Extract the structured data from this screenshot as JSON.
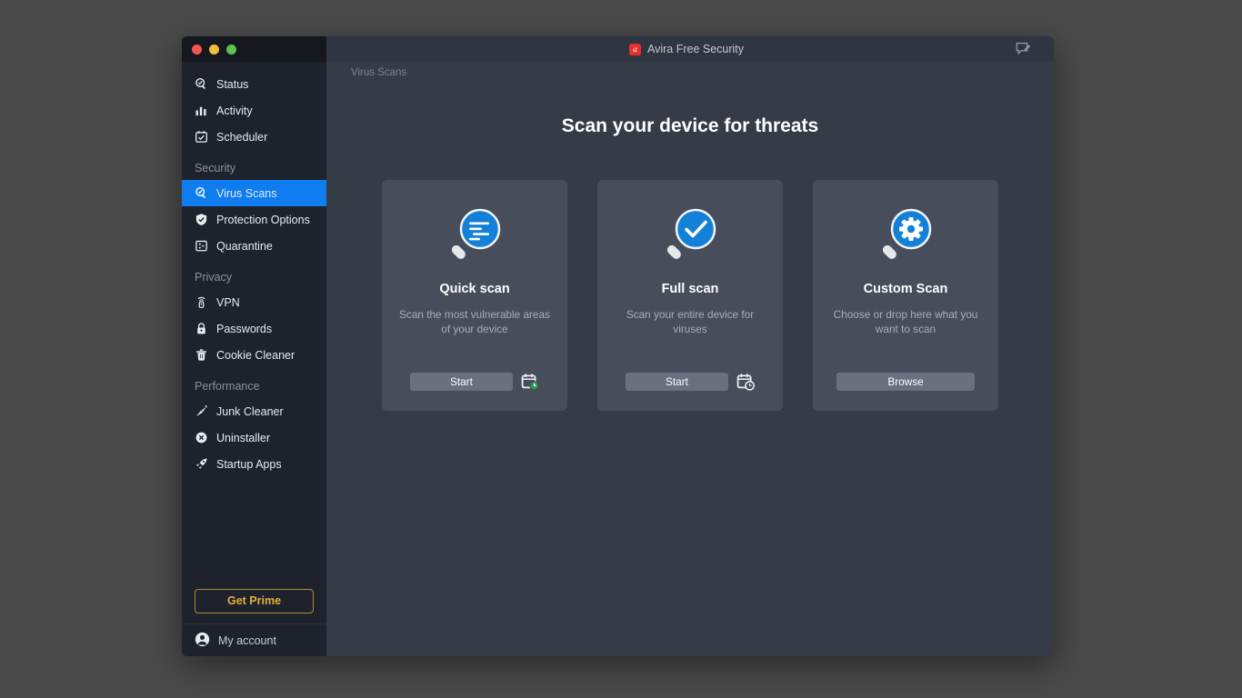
{
  "window": {
    "app_title": "Avira Free Security",
    "logo_glyph": "α",
    "traffic_lights": [
      "close",
      "minimize",
      "maximize"
    ],
    "feedback_icon": "feedback-pencil-icon"
  },
  "sidebar": {
    "top_items": [
      {
        "label": "Status",
        "icon": "magnifier-check-icon"
      },
      {
        "label": "Activity",
        "icon": "bar-chart-icon"
      },
      {
        "label": "Scheduler",
        "icon": "calendar-check-icon"
      }
    ],
    "groups": [
      {
        "title": "Security",
        "items": [
          {
            "label": "Virus Scans",
            "icon": "magnifier-check-icon",
            "selected": true
          },
          {
            "label": "Protection Options",
            "icon": "shield-check-icon",
            "selected": false
          },
          {
            "label": "Quarantine",
            "icon": "quarantine-box-icon",
            "selected": false
          }
        ]
      },
      {
        "title": "Privacy",
        "items": [
          {
            "label": "VPN",
            "icon": "vpn-signal-icon",
            "selected": false
          },
          {
            "label": "Passwords",
            "icon": "lock-icon",
            "selected": false
          },
          {
            "label": "Cookie Cleaner",
            "icon": "trash-icon",
            "selected": false
          }
        ]
      },
      {
        "title": "Performance",
        "items": [
          {
            "label": "Junk Cleaner",
            "icon": "broom-icon",
            "selected": false
          },
          {
            "label": "Uninstaller",
            "icon": "x-circle-icon",
            "selected": false
          },
          {
            "label": "Startup Apps",
            "icon": "rocket-icon",
            "selected": false
          }
        ]
      }
    ],
    "get_prime_label": "Get Prime",
    "account_label": "My account",
    "account_icon": "user-avatar-icon",
    "accent_selected": "#0f7df0",
    "prime_color": "#e3b13c"
  },
  "main": {
    "breadcrumb": "Virus Scans",
    "page_title": "Scan your device for threats",
    "cards": [
      {
        "id": "quick-scan",
        "title": "Quick scan",
        "description": "Scan the most vulnerable areas of your device",
        "icon": "magnifier-list-icon",
        "button_label": "Start",
        "has_schedule": true,
        "schedule_icon": "calendar-clock-green-icon"
      },
      {
        "id": "full-scan",
        "title": "Full scan",
        "description": "Scan your entire device for viruses",
        "icon": "magnifier-check-blue-icon",
        "button_label": "Start",
        "has_schedule": true,
        "schedule_icon": "calendar-clock-icon"
      },
      {
        "id": "custom-scan",
        "title": "Custom Scan",
        "description": "Choose or drop here what you want to scan",
        "icon": "magnifier-gear-icon",
        "button_label": "Browse",
        "has_schedule": false,
        "schedule_icon": ""
      }
    ]
  }
}
